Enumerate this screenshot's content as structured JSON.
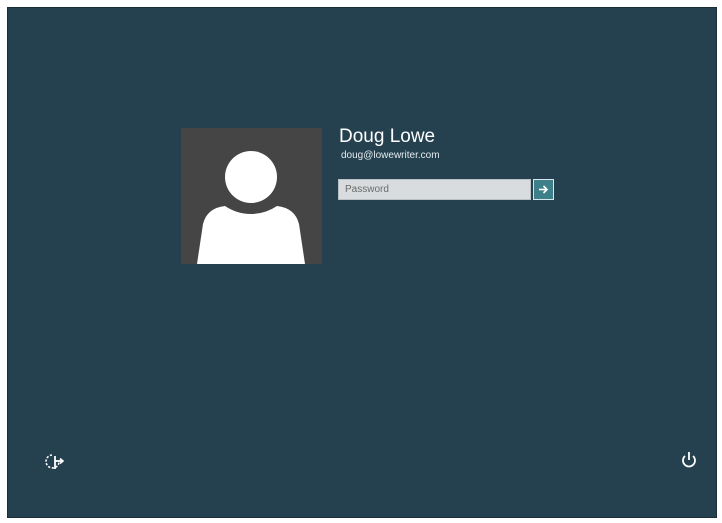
{
  "user": {
    "name": "Doug Lowe",
    "email": "doug@lowewriter.com",
    "avatar_icon": "user-silhouette-icon"
  },
  "password": {
    "value": "",
    "placeholder": "Password",
    "submit_icon": "arrow-right-icon"
  },
  "footer": {
    "ease_of_access_icon": "ease-of-access-icon",
    "power_icon": "power-icon"
  },
  "colors": {
    "background": "#25414f",
    "avatar_bg": "#454545",
    "accent": "#3e8089"
  }
}
